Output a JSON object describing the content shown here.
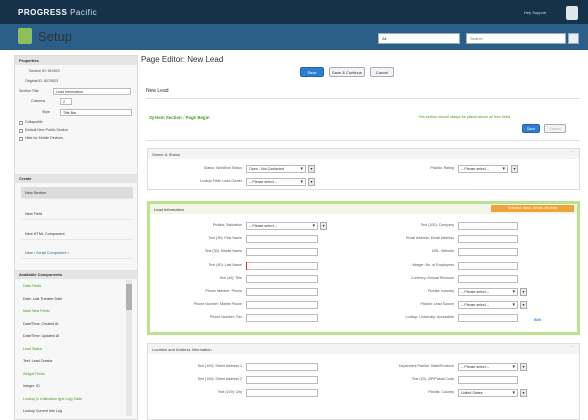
{
  "brand": {
    "name": "PROGRESS",
    "product": "Pacific"
  },
  "user": {
    "label": "Hey Support"
  },
  "setup": {
    "title": "Setup",
    "scope": "All",
    "search_placeholder": "Search"
  },
  "properties": {
    "header": "Properties",
    "section_id": "Section ID: 510923",
    "original_id": "Original ID: 6075523",
    "section_title_label": "Section Title",
    "section_title_value": "Lead Information",
    "columns_label": "Columns",
    "columns_value": "2",
    "style_label": "Style",
    "style_value": "Title Bar",
    "collapsible": "Collapsible",
    "default_new": "Default New Public Section",
    "hide_mobile": "Hide for Mobile Devices"
  },
  "create": {
    "header": "Create",
    "items": [
      "New Section",
      "New Field",
      "New HTML Component",
      "New • Script Component •"
    ]
  },
  "components": {
    "header": "Available Components",
    "items": [
      {
        "text": "Data Fields",
        "green": true
      },
      {
        "text": "Date: Last Transfer Date",
        "green": false
      },
      {
        "text": "Mark New Fields",
        "green": true
      },
      {
        "text": "Date/Time: Created At",
        "green": false
      },
      {
        "text": "Date/Time: Updated At",
        "green": false
      },
      {
        "text": "Lead Status",
        "green": true
      },
      {
        "text": "Text: Lead Creator",
        "green": false
      },
      {
        "text": "Widget Fields",
        "green": true
      },
      {
        "text": "Integer: ID",
        "green": false
      },
      {
        "text": "Lookup (1 Unification type Log) Table",
        "green": true
      },
      {
        "text": "Lookup Current Info Log",
        "green": false
      }
    ]
  },
  "editor": {
    "title": "Page Editor: New Lead",
    "save": "Save",
    "save_continue": "Save & Continue",
    "cancel": "Cancel",
    "record_title": "New Lead",
    "system_section": "System Section - Page Begin",
    "system_note": "This section should always be placed above all form fields",
    "save_small": "Save",
    "cancel_small": "Cancel"
  },
  "owner_section": {
    "header": "Owner & Status",
    "status_label": "Status: Workflow Status",
    "status_value": "Open - Not Contacted",
    "owner_label": "Lookup Field: Lead Owner",
    "owner_value": "-- Please select --",
    "rating_label": "Picklist: Rating",
    "rating_value": "-- Please select --"
  },
  "lead_section": {
    "header": "Lead Information",
    "badge": "Selected: Move, Delete, Set Attrs",
    "left": [
      {
        "label": "Picklist: Salutation",
        "value": "-- Please select --",
        "select": true
      },
      {
        "label": "Text (30): First Name",
        "value": "",
        "select": false
      },
      {
        "label": "Text (30): Middle Name",
        "value": "",
        "select": false
      },
      {
        "label": "Text (40): Last Name",
        "value": "",
        "select": false
      },
      {
        "label": "Text (40): Title",
        "value": "",
        "select": false
      },
      {
        "label": "Phone Number: Phone",
        "value": "",
        "select": false
      },
      {
        "label": "Phone Number: Mobile Phone",
        "value": "",
        "select": false
      },
      {
        "label": "Phone Number: Fax",
        "value": "",
        "select": false
      }
    ],
    "right": [
      {
        "label": "Text (100): Company",
        "value": "",
        "select": false
      },
      {
        "label": "Email Address: Email Address",
        "value": "",
        "select": false
      },
      {
        "label": "URL: Website",
        "value": "",
        "select": false
      },
      {
        "label": "Integer: No. of Employees",
        "value": "",
        "select": false
      },
      {
        "label": "Currency: Annual Revenue",
        "value": "",
        "select": false
      },
      {
        "label": "Picklist: Industry",
        "value": "-- Please select --",
        "select": true
      },
      {
        "label": "Picklist: Lead Source",
        "value": "-- Please select --",
        "select": true
      },
      {
        "label": "Lookup: University: Accessible",
        "value": "",
        "select": false
      }
    ],
    "edit_link": "Edit"
  },
  "location_section": {
    "header": "Location and Address Information",
    "left": [
      {
        "label": "Text (100): Street Address 1",
        "value": ""
      },
      {
        "label": "Text (100): Street Address 2",
        "value": ""
      },
      {
        "label": "Text (100): City",
        "value": ""
      }
    ],
    "right": [
      {
        "label": "Dependent Picklist: State/Province",
        "value": "-- Please select --",
        "select": true
      },
      {
        "label": "Text (20): ZIP/Postal Code",
        "value": "",
        "select": false
      },
      {
        "label": "Picklist: Country",
        "value": "United States",
        "select": true
      }
    ]
  }
}
